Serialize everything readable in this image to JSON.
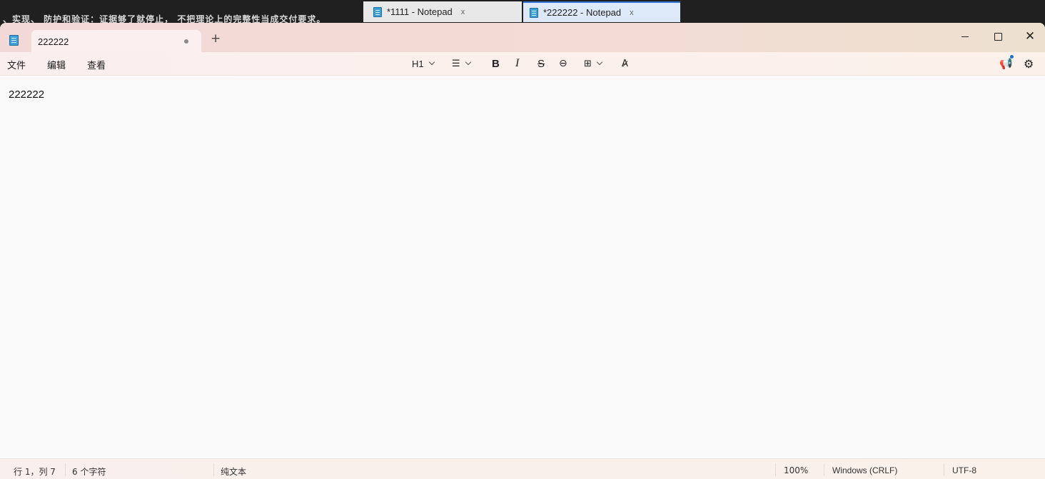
{
  "background": {
    "text": "、实现、 防护和验证：证据够了就停止， 不把理论上的完整性当成交付要求。"
  },
  "taskbar": {
    "tabs": [
      {
        "title": "*1111 - Notepad",
        "close": "x"
      },
      {
        "title": "*222222 - Notepad",
        "close": "x"
      }
    ]
  },
  "titlebar": {
    "tab_title": "222222",
    "new_tab": "+",
    "close_glyph": "✕"
  },
  "menu": {
    "file": "文件",
    "edit": "编辑",
    "view": "查看"
  },
  "toolbar": {
    "heading": "H1",
    "list": "☰",
    "bold": "B",
    "italic": "I",
    "strike": "S",
    "link": "⊖",
    "table": "⊞",
    "spell": "A̷",
    "announce": "📢",
    "settings": "⚙"
  },
  "editor": {
    "content": "222222"
  },
  "status": {
    "position": "行 1，列 7",
    "chars": "6 个字符",
    "type": "纯文本",
    "zoom": "100%",
    "line_ending": "Windows (CRLF)",
    "encoding": "UTF-8"
  },
  "colors": {
    "accent": "#2f6fd6",
    "notepad_icon": "#3aa0d6"
  }
}
